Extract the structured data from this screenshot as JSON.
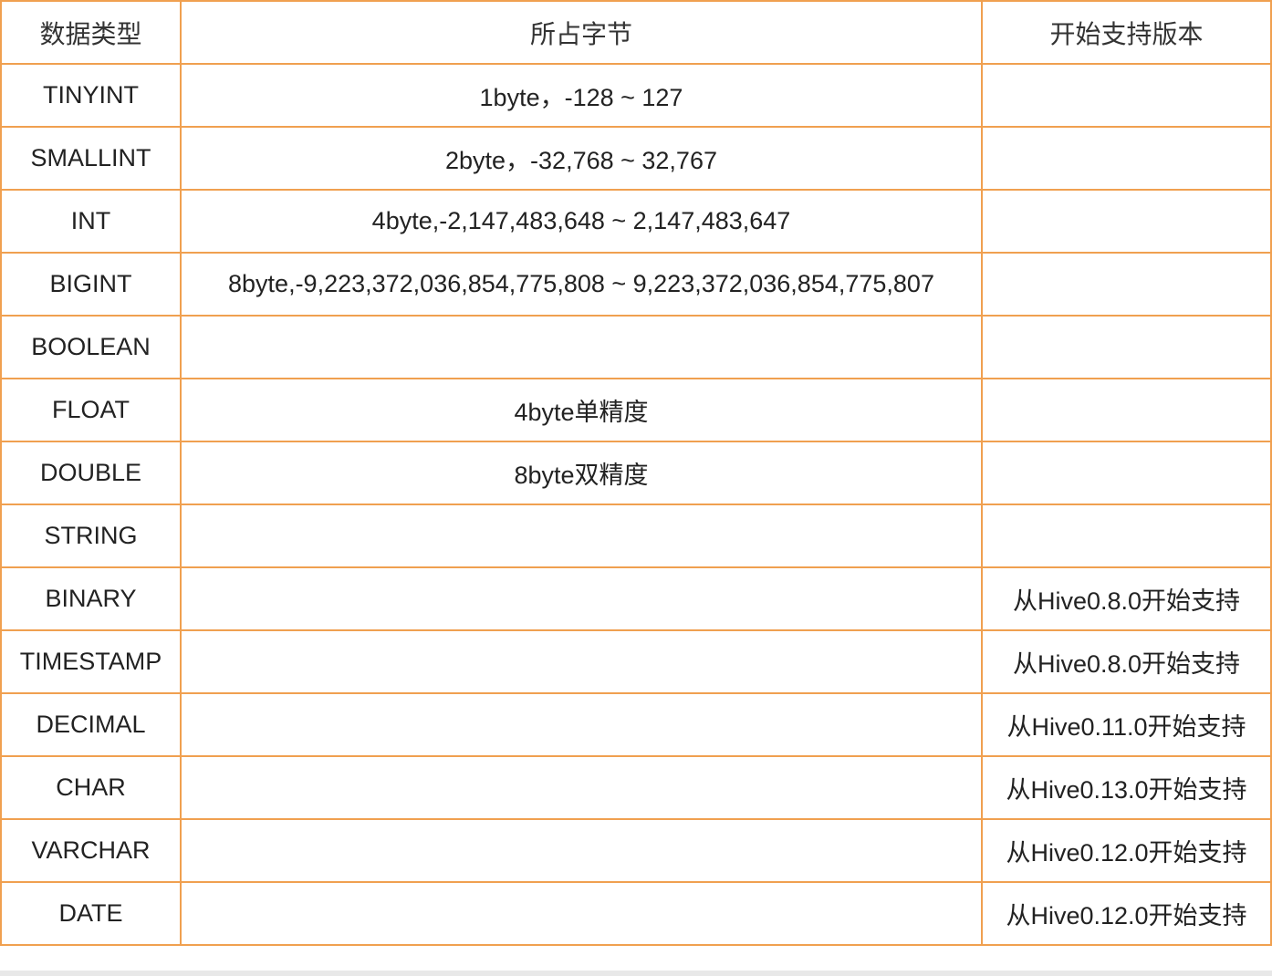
{
  "colors": {
    "border": "#f0a050",
    "text": "#222222",
    "background": "#ffffff"
  },
  "header": {
    "col1": "数据类型",
    "col2": "所占字节",
    "col3": "开始支持版本"
  },
  "rows": [
    {
      "type": "TINYINT",
      "bytes": "1byte，-128 ~ 127",
      "since": ""
    },
    {
      "type": "SMALLINT",
      "bytes": "2byte，-32,768 ~ 32,767",
      "since": ""
    },
    {
      "type": "INT",
      "bytes": "4byte,-2,147,483,648 ~ 2,147,483,647",
      "since": ""
    },
    {
      "type": "BIGINT",
      "bytes": "8byte,-9,223,372,036,854,775,808 ~ 9,223,372,036,854,775,807",
      "since": ""
    },
    {
      "type": "BOOLEAN",
      "bytes": "",
      "since": ""
    },
    {
      "type": "FLOAT",
      "bytes": "4byte单精度",
      "since": ""
    },
    {
      "type": "DOUBLE",
      "bytes": "8byte双精度",
      "since": ""
    },
    {
      "type": "STRING",
      "bytes": "",
      "since": ""
    },
    {
      "type": "BINARY",
      "bytes": "",
      "since": "从Hive0.8.0开始支持"
    },
    {
      "type": "TIMESTAMP",
      "bytes": "",
      "since": "从Hive0.8.0开始支持"
    },
    {
      "type": "DECIMAL",
      "bytes": "",
      "since": "从Hive0.11.0开始支持"
    },
    {
      "type": "CHAR",
      "bytes": "",
      "since": "从Hive0.13.0开始支持"
    },
    {
      "type": "VARCHAR",
      "bytes": "",
      "since": "从Hive0.12.0开始支持"
    },
    {
      "type": "DATE",
      "bytes": "",
      "since": "从Hive0.12.0开始支持"
    }
  ]
}
